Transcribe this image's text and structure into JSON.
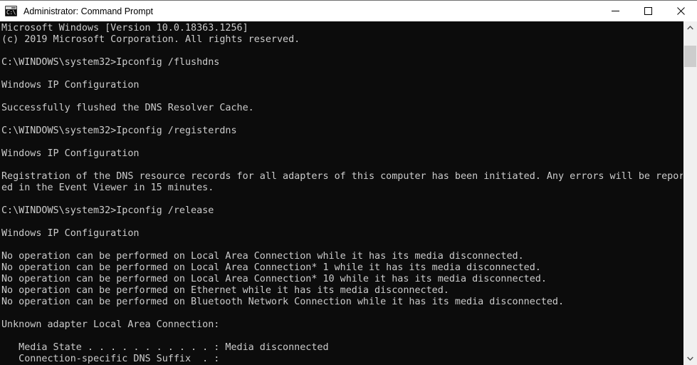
{
  "window": {
    "title": "Administrator: Command Prompt",
    "icon": "cmd-console-icon",
    "icon_glyph": "C:\\.",
    "background": "#0c0c0c",
    "text_color": "#cccccc",
    "titlebar_color": "#ffffff"
  },
  "controls": {
    "minimize_label": "Minimize",
    "maximize_label": "Maximize",
    "close_label": "Close"
  },
  "scrollbar": {
    "up_arrow": "scroll-up",
    "down_arrow": "scroll-down",
    "thumb": "scroll-thumb"
  },
  "console": {
    "lines": [
      "Microsoft Windows [Version 10.0.18363.1256]",
      "(c) 2019 Microsoft Corporation. All rights reserved.",
      "",
      "C:\\WINDOWS\\system32>Ipconfig /flushdns",
      "",
      "Windows IP Configuration",
      "",
      "Successfully flushed the DNS Resolver Cache.",
      "",
      "C:\\WINDOWS\\system32>Ipconfig /registerdns",
      "",
      "Windows IP Configuration",
      "",
      "Registration of the DNS resource records for all adapters of this computer has been initiated. Any errors will be report",
      "ed in the Event Viewer in 15 minutes.",
      "",
      "C:\\WINDOWS\\system32>Ipconfig /release",
      "",
      "Windows IP Configuration",
      "",
      "No operation can be performed on Local Area Connection while it has its media disconnected.",
      "No operation can be performed on Local Area Connection* 1 while it has its media disconnected.",
      "No operation can be performed on Local Area Connection* 10 while it has its media disconnected.",
      "No operation can be performed on Ethernet while it has its media disconnected.",
      "No operation can be performed on Bluetooth Network Connection while it has its media disconnected.",
      "",
      "Unknown adapter Local Area Connection:",
      "",
      "   Media State . . . . . . . . . . . : Media disconnected",
      "   Connection-specific DNS Suffix  . :"
    ]
  }
}
